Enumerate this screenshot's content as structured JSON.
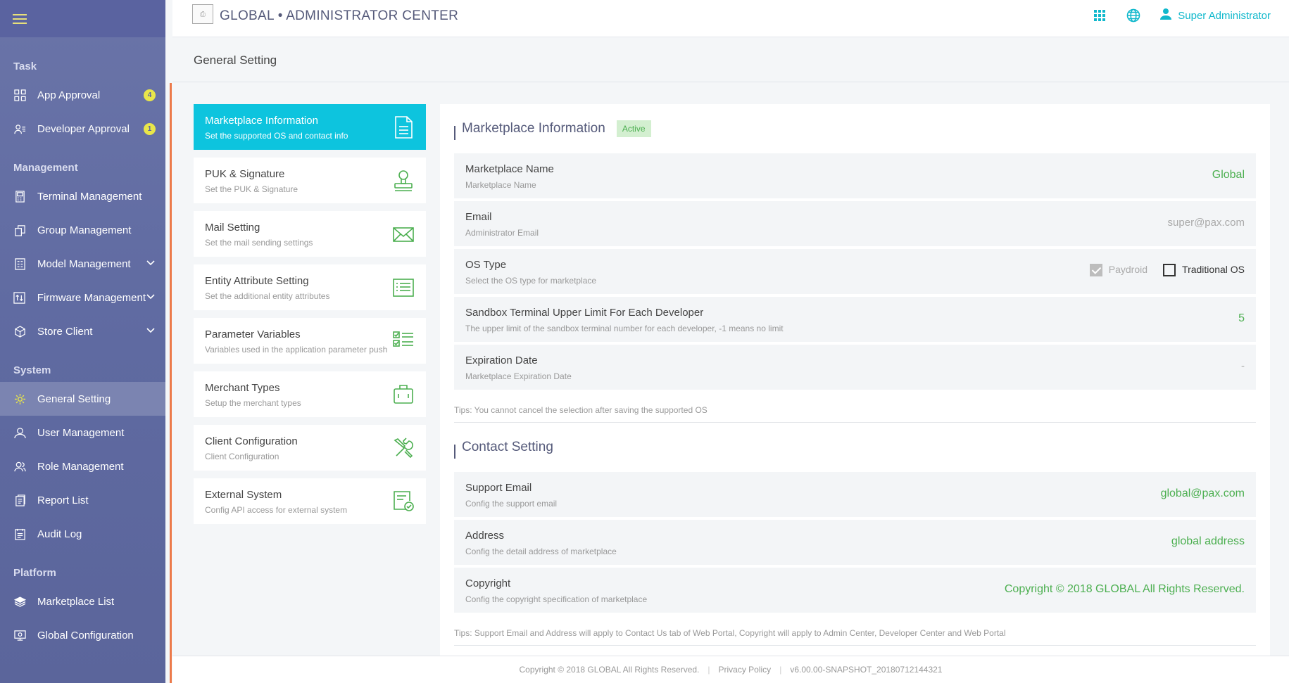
{
  "header": {
    "logo_text": "⎙",
    "title": "GLOBAL • ADMINISTRATOR CENTER",
    "user": "Super Administrator",
    "accent": "#10b8cc"
  },
  "sidebar": {
    "sections": [
      {
        "title": "Task",
        "items": [
          {
            "label": "App Approval",
            "icon": "apps-icon",
            "badge": "4"
          },
          {
            "label": "Developer Approval",
            "icon": "developer-icon",
            "badge": "1"
          }
        ]
      },
      {
        "title": "Management",
        "items": [
          {
            "label": "Terminal Management",
            "icon": "terminal-icon"
          },
          {
            "label": "Group Management",
            "icon": "group-icon"
          },
          {
            "label": "Model Management",
            "icon": "model-icon",
            "expand": true
          },
          {
            "label": "Firmware Management",
            "icon": "firmware-icon",
            "expand": true
          },
          {
            "label": "Store Client",
            "icon": "store-icon",
            "expand": true
          }
        ]
      },
      {
        "title": "System",
        "items": [
          {
            "label": "General Setting",
            "icon": "gear-icon",
            "active": true
          },
          {
            "label": "User Management",
            "icon": "user-icon"
          },
          {
            "label": "Role Management",
            "icon": "role-icon"
          },
          {
            "label": "Report List",
            "icon": "report-icon"
          },
          {
            "label": "Audit Log",
            "icon": "log-icon"
          }
        ]
      },
      {
        "title": "Platform",
        "items": [
          {
            "label": "Marketplace List",
            "icon": "layers-icon"
          },
          {
            "label": "Global Configuration",
            "icon": "monitor-icon"
          }
        ]
      }
    ]
  },
  "page": {
    "title": "General Setting"
  },
  "settings_menu": [
    {
      "title": "Marketplace Information",
      "subtitle": "Set the supported OS and contact info",
      "icon": "document-icon",
      "active": true
    },
    {
      "title": "PUK & Signature",
      "subtitle": "Set the PUK & Signature",
      "icon": "stamp-icon"
    },
    {
      "title": "Mail Setting",
      "subtitle": "Set the mail sending settings",
      "icon": "mail-icon"
    },
    {
      "title": "Entity Attribute Setting",
      "subtitle": "Set the additional entity attributes",
      "icon": "list-icon"
    },
    {
      "title": "Parameter Variables",
      "subtitle": "Variables used in the application parameter push",
      "icon": "checklist-icon"
    },
    {
      "title": "Merchant Types",
      "subtitle": "Setup the merchant types",
      "icon": "briefcase-icon"
    },
    {
      "title": "Client Configuration",
      "subtitle": "Client Configuration",
      "icon": "tools-icon"
    },
    {
      "title": "External System",
      "subtitle": "Config API access for external system",
      "icon": "certificate-icon"
    }
  ],
  "marketplace": {
    "title": "Marketplace Information",
    "status": "Active",
    "rows": [
      {
        "label": "Marketplace Name",
        "sub": "Marketplace Name",
        "value": "Global"
      },
      {
        "label": "Email",
        "sub": "Administrator Email",
        "value": "super@pax.com"
      },
      {
        "label": "OS Type",
        "sub": "Select the OS type for marketplace"
      },
      {
        "label": "Sandbox Terminal Upper Limit For Each Developer",
        "sub": "The upper limit of the sandbox terminal number for each developer, -1 means no limit",
        "value": "5"
      },
      {
        "label": "Expiration Date",
        "sub": "Marketplace Expiration Date",
        "value": "-"
      }
    ],
    "os_options": [
      {
        "label": "Paydroid",
        "checked": true,
        "disabled": true
      },
      {
        "label": "Traditional OS",
        "checked": false
      }
    ],
    "tips": "Tips: You cannot cancel the selection after saving the supported OS"
  },
  "contact": {
    "title": "Contact Setting",
    "rows": [
      {
        "label": "Support Email",
        "sub": "Config the support email",
        "value": "global@pax.com"
      },
      {
        "label": "Address",
        "sub": "Config the detail address of marketplace",
        "value": "global address"
      },
      {
        "label": "Copyright",
        "sub": "Config the copyright specification of marketplace",
        "value": "Copyright © 2018 GLOBAL All Rights Reserved."
      }
    ],
    "tips": "Tips: Support Email and Address will apply to Contact Us tab of Web Portal, Copyright will apply to Admin Center, Developer Center and Web Portal"
  },
  "footer": {
    "copyright": "Copyright © 2018 GLOBAL All Rights Reserved.",
    "privacy": "Privacy Policy",
    "version": "v6.00.00-SNAPSHOT_20180712144321"
  }
}
